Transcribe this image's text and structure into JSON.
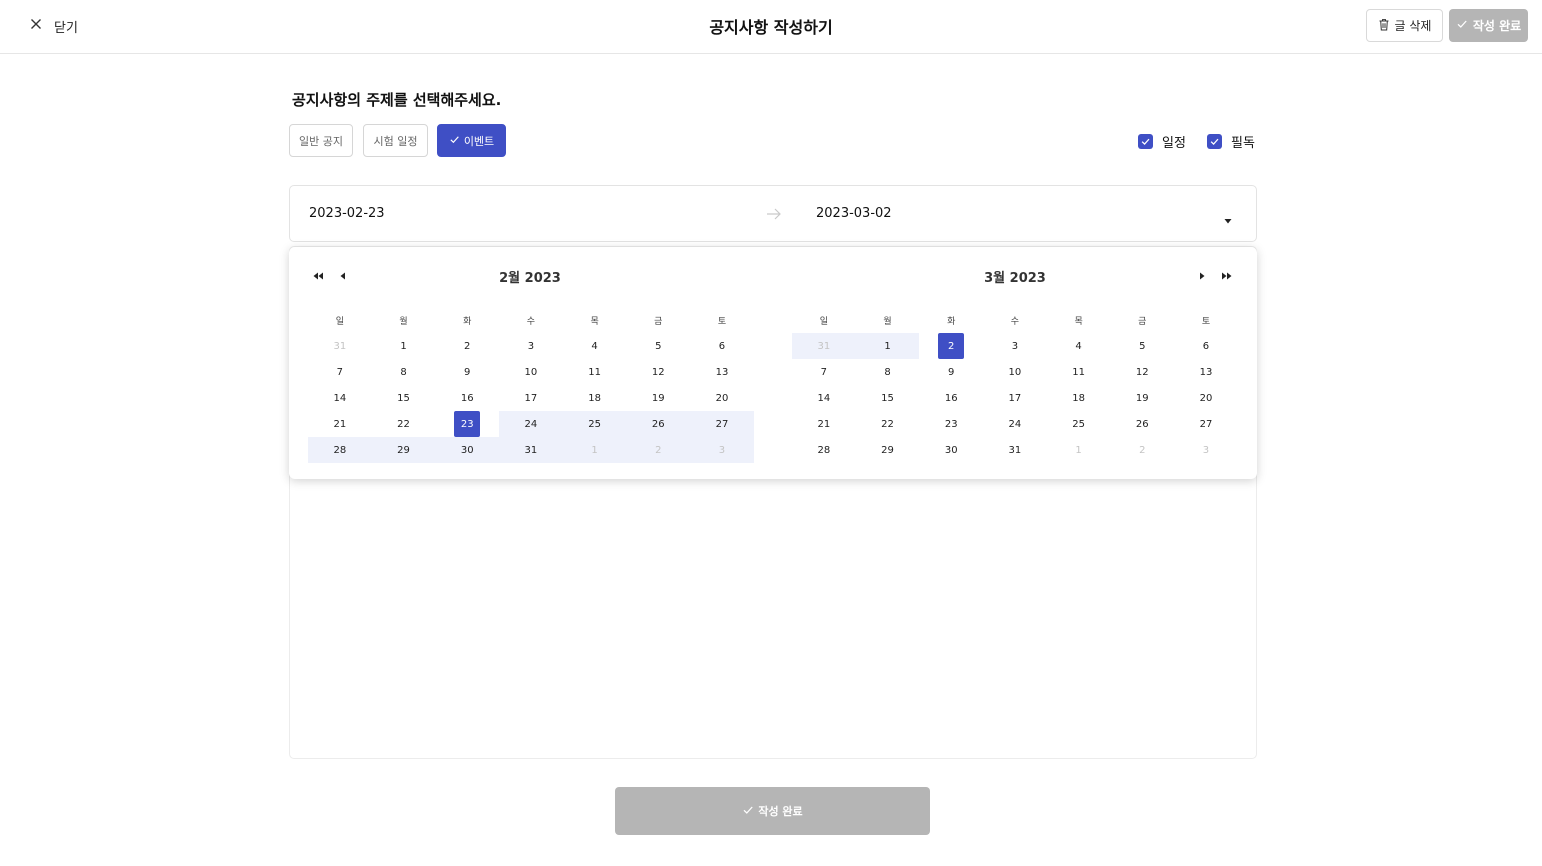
{
  "header": {
    "close_label": "닫기",
    "title": "공지사항 작성하기",
    "delete_label": "글 삭제",
    "complete_label": "작성 완료"
  },
  "topic": {
    "question": "공지사항의 주제를 선택해주세요.",
    "chips": [
      {
        "label": "일반 공지",
        "selected": false
      },
      {
        "label": "시험 일정",
        "selected": false
      },
      {
        "label": "이벤트",
        "selected": true
      }
    ]
  },
  "options": {
    "schedule_label": "일정",
    "schedule_checked": true,
    "required_label": "필독",
    "required_checked": true
  },
  "date_range": {
    "start": "2023-02-23",
    "end": "2023-03-02"
  },
  "calendar": {
    "weekdays": [
      "일",
      "월",
      "화",
      "수",
      "목",
      "금",
      "토"
    ],
    "left_title": "2월 2023",
    "right_title": "3월 2023",
    "left_weeks": [
      [
        "31",
        "1",
        "2",
        "3",
        "4",
        "5",
        "6"
      ],
      [
        "7",
        "8",
        "9",
        "10",
        "11",
        "12",
        "13"
      ],
      [
        "14",
        "15",
        "16",
        "17",
        "18",
        "19",
        "20"
      ],
      [
        "21",
        "22",
        "23",
        "24",
        "25",
        "26",
        "27"
      ],
      [
        "28",
        "29",
        "30",
        "31",
        "1",
        "2",
        "3"
      ]
    ],
    "right_weeks": [
      [
        "31",
        "1",
        "2",
        "3",
        "4",
        "5",
        "6"
      ],
      [
        "7",
        "8",
        "9",
        "10",
        "11",
        "12",
        "13"
      ],
      [
        "14",
        "15",
        "16",
        "17",
        "18",
        "19",
        "20"
      ],
      [
        "21",
        "22",
        "23",
        "24",
        "25",
        "26",
        "27"
      ],
      [
        "28",
        "29",
        "30",
        "31",
        "1",
        "2",
        "3"
      ]
    ]
  },
  "footer": {
    "complete_label": "작성 완료"
  },
  "colors": {
    "accent": "#3f4fc5",
    "range_bg": "#eef1fb",
    "disabled_button": "#b5b5b5"
  }
}
